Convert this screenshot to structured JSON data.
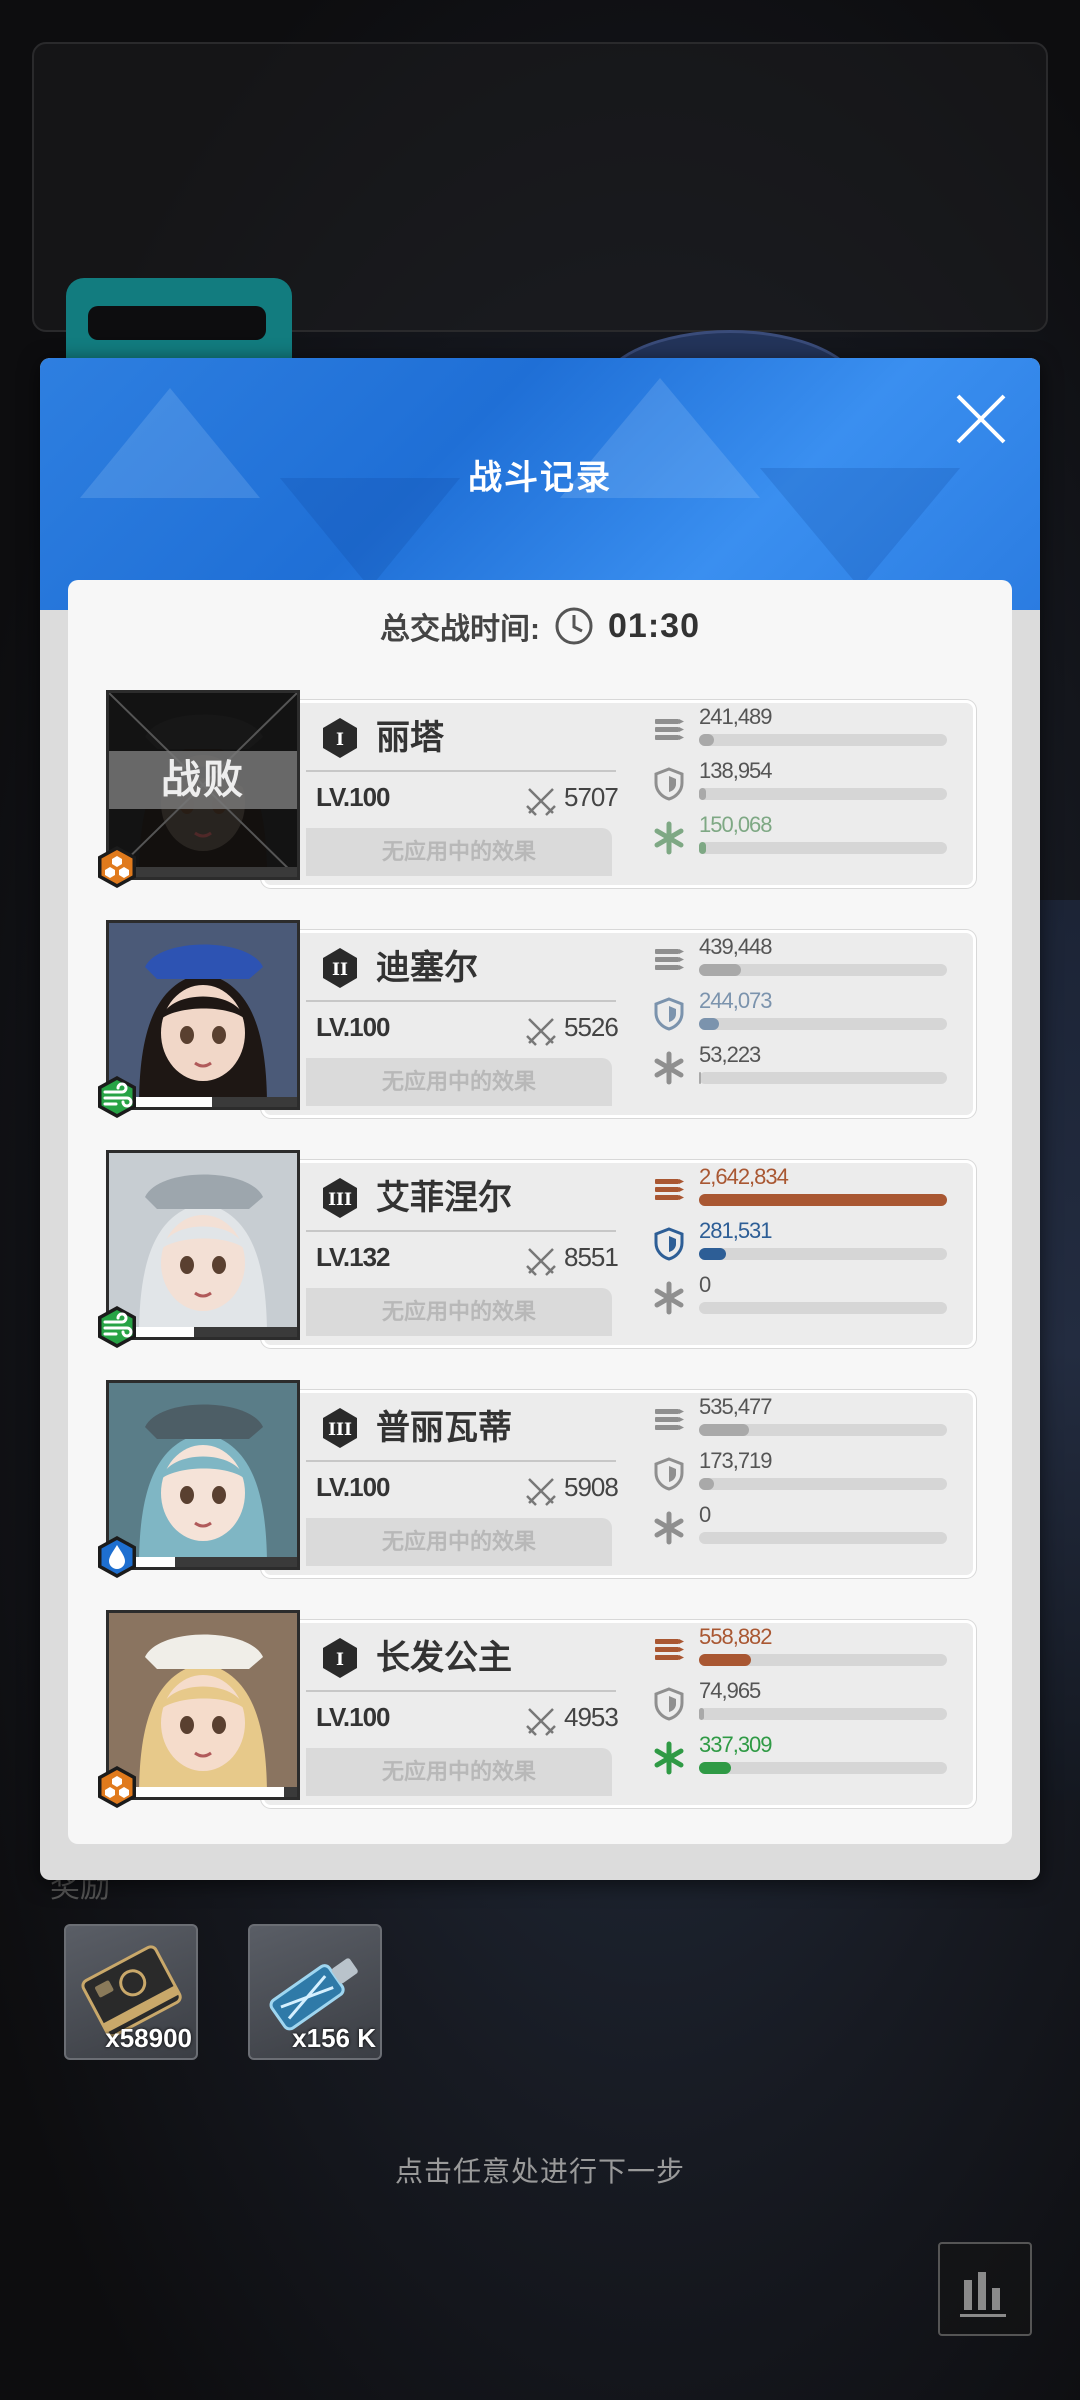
{
  "modal": {
    "title": "战斗记录",
    "timer_label": "总交战时间:",
    "timer_value": "01:30",
    "effects_text": "无应用中的效果"
  },
  "characters": [
    {
      "name": "丽塔",
      "burst": "I",
      "level": "LV.100",
      "kills": "5707",
      "element": "honeycomb-icon",
      "element_color": "#e07a1c",
      "status": "战败",
      "hp_fraction": 0.0,
      "damage": "241,489",
      "damage_fraction": 0.06,
      "damage_color": "#a9a9a9",
      "shield": "138,954",
      "shield_fraction": 0.03,
      "shield_color": "#a9a9a9",
      "heal": "150,068",
      "heal_fraction": 0.03,
      "heal_color": "#7ea884"
    },
    {
      "name": "迪塞尔",
      "burst": "II",
      "level": "LV.100",
      "kills": "5526",
      "element": "wind-icon",
      "element_color": "#27a345",
      "hp_fraction": 0.55,
      "damage": "439,448",
      "damage_fraction": 0.17,
      "damage_color": "#a9a9a9",
      "shield": "244,073",
      "shield_fraction": 0.08,
      "shield_color": "#7b93ad",
      "heal": "53,223",
      "heal_fraction": 0.01,
      "heal_color": "#a9a9a9"
    },
    {
      "name": "艾菲涅尔",
      "burst": "III",
      "level": "LV.132",
      "kills": "8551",
      "element": "wind-icon",
      "element_color": "#27a345",
      "hp_fraction": 0.45,
      "damage": "2,642,834",
      "damage_fraction": 1.0,
      "damage_color": "#a95732",
      "shield": "281,531",
      "shield_fraction": 0.11,
      "shield_color": "#2d5e96",
      "heal": "0",
      "heal_fraction": 0.0,
      "heal_color": "#a9a9a9"
    },
    {
      "name": "普丽瓦蒂",
      "burst": "III",
      "level": "LV.100",
      "kills": "5908",
      "element": "water-icon",
      "element_color": "#1e6fd0",
      "hp_fraction": 0.35,
      "damage": "535,477",
      "damage_fraction": 0.2,
      "damage_color": "#a9a9a9",
      "shield": "173,719",
      "shield_fraction": 0.06,
      "shield_color": "#a9a9a9",
      "heal": "0",
      "heal_fraction": 0.0,
      "heal_color": "#a9a9a9"
    },
    {
      "name": "长发公主",
      "burst": "I",
      "level": "LV.100",
      "kills": "4953",
      "element": "honeycomb-icon",
      "element_color": "#e07a1c",
      "hp_fraction": 0.93,
      "damage": "558,882",
      "damage_fraction": 0.21,
      "damage_color": "#a95732",
      "shield": "74,965",
      "shield_fraction": 0.02,
      "shield_color": "#a9a9a9",
      "heal": "337,309",
      "heal_fraction": 0.13,
      "heal_color": "#2f9a45"
    }
  ],
  "rewards": {
    "label": "奖励",
    "items": [
      {
        "icon": "credit-card-icon",
        "quantity": "x58900"
      },
      {
        "icon": "core-dust-icon",
        "quantity": "x156 K"
      }
    ]
  },
  "hint": "点击任意处进行下一步",
  "stats_button_icon": "bar-chart-icon"
}
